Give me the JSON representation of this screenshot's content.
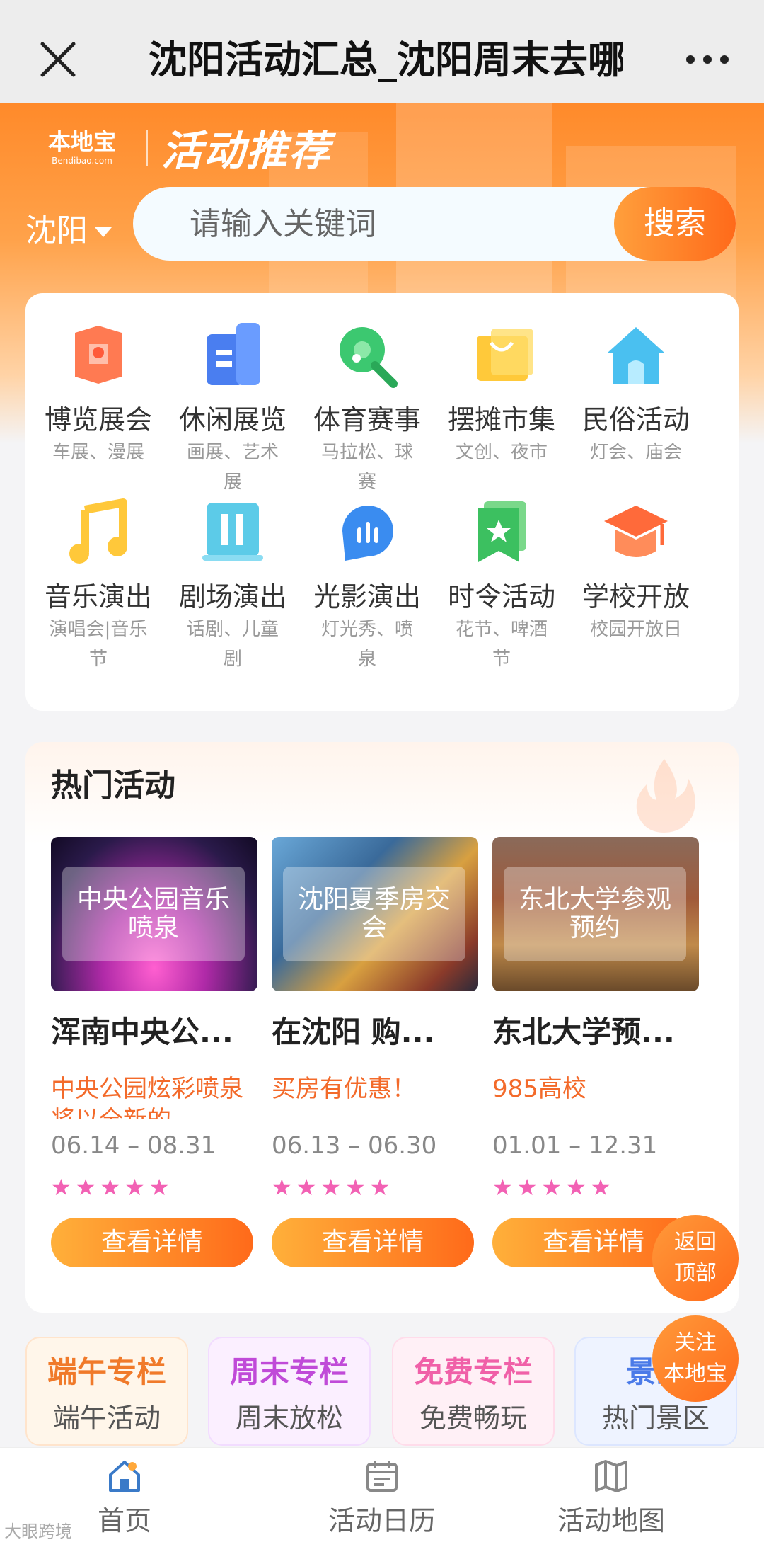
{
  "navbar": {
    "title": "沈阳活动汇总_沈阳周末去哪"
  },
  "brand": {
    "logo_cn": "本地宝",
    "logo_en": "Bendibao.com",
    "slogan": "活动推荐"
  },
  "search": {
    "city": "沈阳",
    "placeholder": "请输入关键词",
    "button": "搜索"
  },
  "categories": [
    {
      "name": "博览展会",
      "sub": "车展、漫展",
      "icon": "map-pin-icon"
    },
    {
      "name": "休闲展览",
      "sub": "画展、艺术展",
      "icon": "exhibition-icon"
    },
    {
      "name": "体育赛事",
      "sub": "马拉松、球赛",
      "icon": "ping-pong-icon"
    },
    {
      "name": "摆摊市集",
      "sub": "文创、夜市",
      "icon": "shopping-bag-icon"
    },
    {
      "name": "民俗活动",
      "sub": "灯会、庙会",
      "icon": "house-icon"
    },
    {
      "name": "音乐演出",
      "sub": "演唱会|音乐节",
      "icon": "music-note-icon"
    },
    {
      "name": "剧场演出",
      "sub": "话剧、儿童剧",
      "icon": "theater-icon"
    },
    {
      "name": "光影演出",
      "sub": "灯光秀、喷泉",
      "icon": "light-show-icon"
    },
    {
      "name": "时令活动",
      "sub": "花节、啤酒节",
      "icon": "star-badge-icon"
    },
    {
      "name": "学校开放",
      "sub": "校园开放日",
      "icon": "graduation-cap-icon"
    }
  ],
  "hot": {
    "heading": "热门活动",
    "items": [
      {
        "overlay": "中央公园音乐喷泉",
        "title": "浑南中央公...",
        "desc": "中央公园炫彩喷泉将以全新的",
        "date": "06.14 – 08.31",
        "stars": 5,
        "button": "查看详情"
      },
      {
        "overlay": "沈阳夏季房交会",
        "title": "在沈阳 购...",
        "desc": "买房有优惠！",
        "date": "06.13 – 06.30",
        "stars": 5,
        "button": "查看详情"
      },
      {
        "overlay": "东北大学参观预约",
        "title": "东北大学预...",
        "desc": "985高校",
        "date": "01.01 – 12.31",
        "stars": 5,
        "button": "查看详情"
      }
    ]
  },
  "fab": {
    "top_l1": "返回",
    "top_l2": "顶部",
    "follow_l1": "关注",
    "follow_l2": "本地宝"
  },
  "columns": [
    {
      "title": "端午专栏",
      "sub": "端午活动",
      "color": "#f07a2a",
      "bg": "#fff6ea"
    },
    {
      "title": "周末专栏",
      "sub": "周末放松",
      "color": "#c04ad8",
      "bg": "#fbefff"
    },
    {
      "title": "免费专栏",
      "sub": "免费畅玩",
      "color": "#f060a8",
      "bg": "#fff0f6"
    },
    {
      "title": "景区",
      "sub": "热门景区",
      "color": "#4a7ae8",
      "bg": "#eef3ff"
    }
  ],
  "tabs": [
    {
      "label": "首页",
      "icon": "home-icon"
    },
    {
      "label": "活动日历",
      "icon": "calendar-icon"
    },
    {
      "label": "活动地图",
      "icon": "map-icon"
    }
  ],
  "watermark": "大眼跨境"
}
